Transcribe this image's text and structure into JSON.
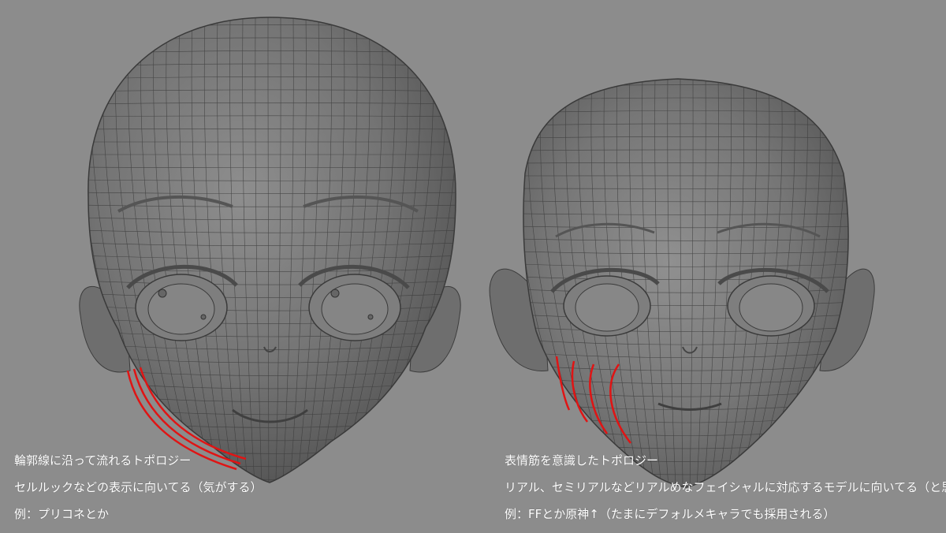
{
  "left_panel": {
    "caption_lines": [
      "輪郭線に沿って流れるトポロジー",
      "セルルックなどの表示に向いてる（気がする）",
      "例：プリコネとか"
    ],
    "annotation_color": "#e01414"
  },
  "right_panel": {
    "caption_lines": [
      "表情筋を意識したトポロジー",
      "リアル、セミリアルなどリアルめなフェイシャルに対応するモデルに向いてる（と思う）",
      "例：FFとか原神↑（たまにデフォルメキャラでも採用される）"
    ],
    "annotation_color": "#e01414"
  },
  "colors": {
    "background": "#8c8c8c",
    "mesh_fill": "#7a7a7a",
    "wire": "#3c3c3c"
  }
}
